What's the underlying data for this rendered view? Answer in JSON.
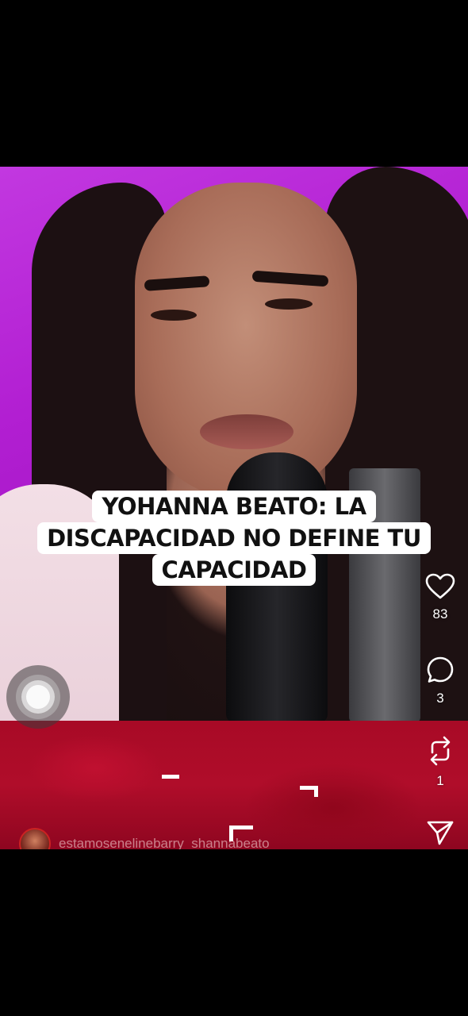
{
  "video": {
    "caption_lines": [
      "YOHANNA BEATO: LA",
      "DISCAPACIDAD NO DEFINE TU",
      "CAPACIDAD"
    ]
  },
  "actions": {
    "like": {
      "icon": "heart-icon",
      "count": "83"
    },
    "comment": {
      "icon": "comment-icon",
      "count": "3"
    },
    "repost": {
      "icon": "repost-icon",
      "count": "1"
    },
    "share": {
      "icon": "send-icon"
    }
  },
  "next_post": {
    "author": "estamosenelinebarry_shannabeato"
  },
  "colors": {
    "background": "#000000",
    "backdrop_magenta": "#b21fd2",
    "next_preview_red": "#a80a26",
    "caption_bg": "#ffffff",
    "icon_color": "#ffffff"
  }
}
